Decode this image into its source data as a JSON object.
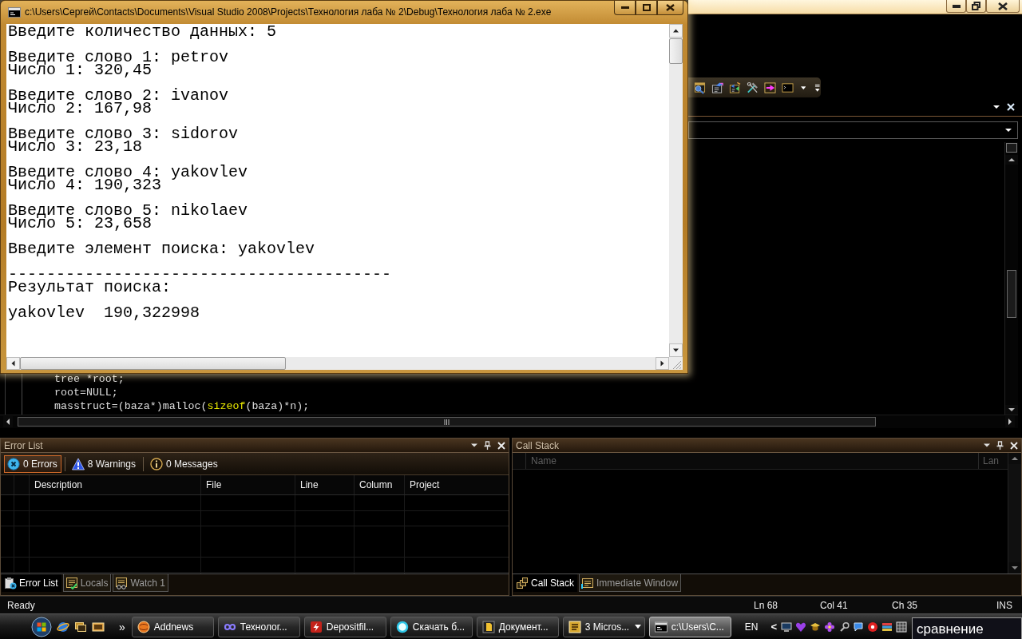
{
  "console_window": {
    "title": "c:\\Users\\Сергей\\Contacts\\Documents\\Visual Studio 2008\\Projects\\Технология лаба № 2\\Debug\\Технология лаба № 2.exe",
    "blocks": [
      {
        "kind": "plain",
        "lines": [
          "Введите количество данных: 5"
        ]
      },
      {
        "kind": "plain",
        "lines": [
          "Введите слово 1: petrov",
          "Число 1: 320,45"
        ]
      },
      {
        "kind": "plain",
        "lines": [
          "Введите слово 2: ivanov",
          "Число 2: 167,98"
        ]
      },
      {
        "kind": "plain",
        "lines": [
          "Введите слово 3: sidorov",
          "Число 3: 23,18"
        ]
      },
      {
        "kind": "plain",
        "lines": [
          "Введите слово 4: yakovlev",
          "Число 4: 190,323"
        ]
      },
      {
        "kind": "plain",
        "lines": [
          "Введите слово 5: nikolaev",
          "Число 5: 23,658"
        ]
      },
      {
        "kind": "plain",
        "lines": [
          "Введите элемент поиска: yakovlev"
        ]
      },
      {
        "kind": "spaced",
        "lines": [
          "----------------------------------------",
          "Результат поиска:"
        ]
      },
      {
        "kind": "plain",
        "lines": [
          "yakovlev  190,322998"
        ]
      }
    ]
  },
  "editor": {
    "code_lines": [
      {
        "tokens": [
          {
            "kind": "plain",
            "text": "tree *root;"
          }
        ]
      },
      {
        "tokens": [
          {
            "kind": "plain",
            "text": "root=NULL;"
          }
        ]
      },
      {
        "tokens": [
          {
            "kind": "plain",
            "text": "masstruct=(baza*)malloc("
          },
          {
            "kind": "keyword",
            "text": "sizeof"
          },
          {
            "kind": "plain",
            "text": "(baza)*n);"
          }
        ]
      }
    ]
  },
  "error_list": {
    "title": "Error List",
    "filters": [
      {
        "kind": "error",
        "label": "0 Errors",
        "selected": true
      },
      {
        "kind": "warning",
        "label": "8 Warnings",
        "selected": false
      },
      {
        "kind": "message",
        "label": "0 Messages",
        "selected": false
      }
    ],
    "columns": [
      "Description",
      "File",
      "Line",
      "Column",
      "Project"
    ],
    "tabs": [
      {
        "kind": "errors",
        "label": "Error List",
        "selected": true
      },
      {
        "kind": "locals",
        "label": "Locals",
        "selected": false
      },
      {
        "kind": "watch",
        "label": "Watch 1",
        "selected": false
      }
    ]
  },
  "call_stack": {
    "title": "Call Stack",
    "columns": [
      "Name",
      "Lan"
    ],
    "tabs": [
      {
        "kind": "call_stack",
        "label": "Call Stack",
        "selected": true
      },
      {
        "kind": "immediate",
        "label": "Immediate Window",
        "selected": false
      }
    ]
  },
  "status_bar": {
    "message": "Ready",
    "line": "Ln 68",
    "column": "Col 41",
    "char": "Ch 35",
    "mode": "INS"
  },
  "taskbar": {
    "more": "»",
    "buttons": [
      {
        "kind": "browser",
        "label": "Addnews",
        "selected": false,
        "grouped": false
      },
      {
        "kind": "studio",
        "label": "Технолог...",
        "selected": false,
        "grouped": false
      },
      {
        "kind": "ftp",
        "label": "Depositfil...",
        "selected": false,
        "grouped": false
      },
      {
        "kind": "downloader",
        "label": "Скачать б...",
        "selected": false,
        "grouped": false
      },
      {
        "kind": "document",
        "label": "Документ...",
        "selected": false,
        "grouped": false
      },
      {
        "kind": "word",
        "label": "3 Micros...",
        "selected": false,
        "grouped": true
      },
      {
        "kind": "console",
        "label": "c:\\Users\\C...",
        "selected": true,
        "grouped": false
      }
    ],
    "language": "EN",
    "tray_expand": "<",
    "popup_text": "сравнение"
  }
}
